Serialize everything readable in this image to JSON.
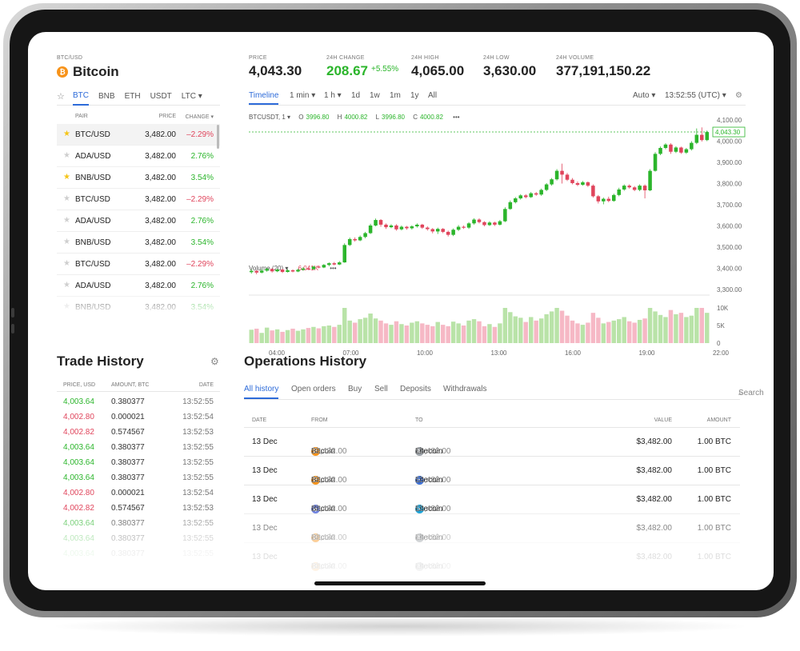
{
  "coin": {
    "pair": "BTC/USD",
    "name": "Bitcoin",
    "icon": "bitcoin-icon",
    "icon_glyph": "₿"
  },
  "stats": {
    "price": {
      "label": "PRICE",
      "value": "4,043.30"
    },
    "change": {
      "label": "24H CHANGE",
      "value": "208.67",
      "pct": "+5.55%"
    },
    "high": {
      "label": "24H HIGH",
      "value": "4,065.00"
    },
    "low": {
      "label": "24H LOW",
      "value": "3,630.00"
    },
    "volume": {
      "label": "24H VOLUME",
      "value": "377,191,150.22"
    }
  },
  "market": {
    "star": "☆",
    "tabs": [
      "BTC",
      "BNB",
      "ETH",
      "USDT",
      "LTC ▾"
    ],
    "headers": {
      "pair": "PAIR",
      "price": "PRICE",
      "change": "CHANGE ▾"
    },
    "rows": [
      {
        "fav": true,
        "pair": "BTC/USD",
        "price": "3,482.00",
        "change": "–2.29%",
        "dir": "down"
      },
      {
        "fav": false,
        "pair": "ADA/USD",
        "price": "3,482.00",
        "change": "2.76%",
        "dir": "up"
      },
      {
        "fav": true,
        "pair": "BNB/USD",
        "price": "3,482.00",
        "change": "3.54%",
        "dir": "up"
      },
      {
        "fav": false,
        "pair": "BTC/USD",
        "price": "3,482.00",
        "change": "–2.29%",
        "dir": "down"
      },
      {
        "fav": false,
        "pair": "ADA/USD",
        "price": "3,482.00",
        "change": "2.76%",
        "dir": "up"
      },
      {
        "fav": false,
        "pair": "BNB/USD",
        "price": "3,482.00",
        "change": "3.54%",
        "dir": "up"
      },
      {
        "fav": false,
        "pair": "BTC/USD",
        "price": "3,482.00",
        "change": "–2.29%",
        "dir": "down"
      },
      {
        "fav": false,
        "pair": "ADA/USD",
        "price": "3,482.00",
        "change": "2.76%",
        "dir": "up"
      },
      {
        "fav": false,
        "pair": "BNB/USD",
        "price": "3,482.00",
        "change": "3.54%",
        "dir": "up"
      }
    ]
  },
  "chart_tabs": {
    "timeline": "Timeline",
    "min": "1 min ▾",
    "hour": "1 h ▾",
    "d": "1d",
    "w": "1w",
    "m": "1m",
    "y": "1y",
    "all": "All",
    "auto": "Auto ▾",
    "clock": "13:52:55 (UTC) ▾"
  },
  "ohlc": {
    "symbol": "BTCUSDT, 1 ▾",
    "o": "3996.80",
    "h": "4000.82",
    "l": "3996.80",
    "c": "4000.82",
    "more": "•••"
  },
  "volume_label": {
    "label": "Volume (20) ▾",
    "value": "6.041K",
    "more": "•••"
  },
  "chart_data": {
    "type": "candlestick",
    "x_ticks": [
      "04:00",
      "07:00",
      "10:00",
      "13:00",
      "16:00",
      "19:00",
      "22:00"
    ],
    "y_ticks": [
      "4,100.00",
      "4,000.00",
      "3,900.00",
      "3,800.00",
      "3,700.00",
      "3,600.00",
      "3,500.00",
      "3,400.00",
      "3,300.00"
    ],
    "ylim": [
      3300,
      4100
    ],
    "last_price_label": "4,043.30",
    "last_price": 4043.3,
    "volume_ticks": [
      "10K",
      "5K",
      "0"
    ],
    "volume_ylim": [
      0,
      10000
    ],
    "candles": [
      [
        3382,
        3388,
        3375,
        3395
      ],
      [
        3388,
        3380,
        3372,
        3392
      ],
      [
        3380,
        3389,
        3376,
        3396
      ],
      [
        3389,
        3397,
        3384,
        3402
      ],
      [
        3397,
        3386,
        3380,
        3400
      ],
      [
        3386,
        3394,
        3382,
        3399
      ],
      [
        3394,
        3383,
        3378,
        3398
      ],
      [
        3383,
        3391,
        3380,
        3396
      ],
      [
        3391,
        3385,
        3381,
        3395
      ],
      [
        3385,
        3393,
        3382,
        3398
      ],
      [
        3393,
        3399,
        3388,
        3405
      ],
      [
        3399,
        3396,
        3392,
        3404
      ],
      [
        3396,
        3408,
        3393,
        3412
      ],
      [
        3408,
        3404,
        3400,
        3414
      ],
      [
        3404,
        3416,
        3401,
        3420
      ],
      [
        3416,
        3424,
        3410,
        3428
      ],
      [
        3424,
        3418,
        3414,
        3430
      ],
      [
        3418,
        3428,
        3415,
        3434
      ],
      [
        3428,
        3510,
        3426,
        3518
      ],
      [
        3510,
        3538,
        3505,
        3545
      ],
      [
        3538,
        3532,
        3526,
        3546
      ],
      [
        3532,
        3548,
        3528,
        3555
      ],
      [
        3548,
        3566,
        3542,
        3572
      ],
      [
        3566,
        3602,
        3562,
        3610
      ],
      [
        3602,
        3628,
        3598,
        3635
      ],
      [
        3628,
        3606,
        3596,
        3632
      ],
      [
        3606,
        3594,
        3586,
        3612
      ],
      [
        3594,
        3602,
        3589,
        3608
      ],
      [
        3602,
        3584,
        3578,
        3608
      ],
      [
        3584,
        3596,
        3579,
        3602
      ],
      [
        3596,
        3589,
        3582,
        3600
      ],
      [
        3589,
        3598,
        3583,
        3603
      ],
      [
        3598,
        3606,
        3592,
        3612
      ],
      [
        3606,
        3592,
        3586,
        3610
      ],
      [
        3592,
        3585,
        3578,
        3598
      ],
      [
        3585,
        3574,
        3565,
        3590
      ],
      [
        3574,
        3586,
        3562,
        3592
      ],
      [
        3586,
        3572,
        3566,
        3590
      ],
      [
        3572,
        3558,
        3550,
        3578
      ],
      [
        3558,
        3582,
        3552,
        3588
      ],
      [
        3582,
        3596,
        3576,
        3604
      ],
      [
        3596,
        3592,
        3586,
        3602
      ],
      [
        3592,
        3612,
        3586,
        3618
      ],
      [
        3612,
        3630,
        3606,
        3636
      ],
      [
        3630,
        3618,
        3612,
        3636
      ],
      [
        3618,
        3604,
        3598,
        3622
      ],
      [
        3604,
        3616,
        3600,
        3622
      ],
      [
        3616,
        3606,
        3600,
        3620
      ],
      [
        3606,
        3622,
        3602,
        3628
      ],
      [
        3622,
        3680,
        3618,
        3688
      ],
      [
        3680,
        3712,
        3676,
        3720
      ],
      [
        3712,
        3730,
        3706,
        3736
      ],
      [
        3730,
        3744,
        3724,
        3750
      ],
      [
        3744,
        3736,
        3730,
        3750
      ],
      [
        3736,
        3754,
        3732,
        3760
      ],
      [
        3754,
        3748,
        3742,
        3760
      ],
      [
        3748,
        3770,
        3742,
        3776
      ],
      [
        3770,
        3796,
        3764,
        3802
      ],
      [
        3796,
        3820,
        3790,
        3826
      ],
      [
        3820,
        3860,
        3814,
        3868
      ],
      [
        3860,
        3842,
        3800,
        3894
      ],
      [
        3842,
        3818,
        3812,
        3850
      ],
      [
        3818,
        3802,
        3796,
        3826
      ],
      [
        3802,
        3794,
        3788,
        3810
      ],
      [
        3794,
        3806,
        3790,
        3812
      ],
      [
        3806,
        3790,
        3784,
        3810
      ],
      [
        3790,
        3740,
        3734,
        3796
      ],
      [
        3740,
        3716,
        3706,
        3746
      ],
      [
        3716,
        3728,
        3702,
        3734
      ],
      [
        3728,
        3718,
        3712,
        3738
      ],
      [
        3718,
        3746,
        3714,
        3752
      ],
      [
        3746,
        3772,
        3740,
        3780
      ],
      [
        3772,
        3790,
        3766,
        3796
      ],
      [
        3790,
        3782,
        3776,
        3796
      ],
      [
        3782,
        3770,
        3764,
        3788
      ],
      [
        3770,
        3790,
        3764,
        3796
      ],
      [
        3790,
        3768,
        3730,
        3796
      ],
      [
        3768,
        3860,
        3764,
        3868
      ],
      [
        3860,
        3940,
        3856,
        3948
      ],
      [
        3940,
        3968,
        3934,
        3975
      ],
      [
        3968,
        3984,
        3962,
        3990
      ],
      [
        3984,
        3950,
        3940,
        3990
      ],
      [
        3950,
        3970,
        3944,
        3976
      ],
      [
        3970,
        3946,
        3940,
        3974
      ],
      [
        3946,
        3962,
        3940,
        3968
      ],
      [
        3962,
        3992,
        3956,
        4000
      ],
      [
        3992,
        4030,
        3986,
        4060
      ],
      [
        4030,
        4005,
        3998,
        4065
      ],
      [
        4005,
        4043,
        4000,
        4050
      ]
    ],
    "volumes": [
      3800,
      4100,
      2900,
      4400,
      3600,
      3900,
      3200,
      3700,
      4100,
      3500,
      3900,
      4300,
      4600,
      4200,
      4800,
      5000,
      4600,
      5200,
      10000,
      6400,
      5800,
      6800,
      7200,
      8400,
      7000,
      6400,
      5600,
      5200,
      6200,
      5400,
      5000,
      5800,
      6200,
      5600,
      5200,
      4800,
      6000,
      5200,
      4800,
      6100,
      5600,
      5000,
      6400,
      6800,
      6200,
      4800,
      5400,
      4600,
      5600,
      10000,
      8800,
      7600,
      7200,
      6000,
      7400,
      6400,
      7000,
      8200,
      9000,
      10000,
      9200,
      7800,
      6400,
      5600,
      5200,
      5800,
      8600,
      7200,
      5600,
      6000,
      6400,
      6800,
      7400,
      6200,
      5800,
      6600,
      7000,
      10000,
      9000,
      8000,
      7400,
      9400,
      8200,
      8600,
      7400,
      7800,
      10000,
      10000,
      8600,
      3800
    ]
  },
  "trade_history": {
    "title": "Trade History",
    "headers": {
      "price": "PRICE, USD",
      "amount": "AMOUNT, BTC",
      "date": "DATE"
    },
    "rows": [
      {
        "price": "4,003.64",
        "amount": "0.380377",
        "date": "13:52:55",
        "dir": "up"
      },
      {
        "price": "4,002.80",
        "amount": "0.000021",
        "date": "13:52:54",
        "dir": "down"
      },
      {
        "price": "4,002.82",
        "amount": "0.574567",
        "date": "13:52:53",
        "dir": "down"
      },
      {
        "price": "4,003.64",
        "amount": "0.380377",
        "date": "13:52:55",
        "dir": "up"
      },
      {
        "price": "4,003.64",
        "amount": "0.380377",
        "date": "13:52:55",
        "dir": "up"
      },
      {
        "price": "4,003.64",
        "amount": "0.380377",
        "date": "13:52:55",
        "dir": "up"
      },
      {
        "price": "4,002.80",
        "amount": "0.000021",
        "date": "13:52:54",
        "dir": "down"
      },
      {
        "price": "4,002.82",
        "amount": "0.574567",
        "date": "13:52:53",
        "dir": "down"
      },
      {
        "price": "4,003.64",
        "amount": "0.380377",
        "date": "13:52:55",
        "dir": "up"
      },
      {
        "price": "4,003.64",
        "amount": "0.380377",
        "date": "13:52:55",
        "dir": "up"
      },
      {
        "price": "4,003.64",
        "amount": "0.380377",
        "date": "13:52:55",
        "dir": "up"
      }
    ]
  },
  "operations": {
    "title": "Operations History",
    "tabs": [
      "All history",
      "Open orders",
      "Buy",
      "Sell",
      "Deposits",
      "Withdrawals"
    ],
    "search": "Search",
    "headers": {
      "date": "DATE",
      "from": "FROM",
      "to": "TO",
      "value": "VALUE",
      "amount": "AMOUNT"
    },
    "rows": [
      {
        "date": "13 Dec",
        "from": "Bitcoin",
        "from_amount": "$3,482.00",
        "from_icon": "bitcoin-icon",
        "from_color": "#f7931a",
        "from_glyph": "₿",
        "to": "Litecoin",
        "to_amount": "$3,482.00",
        "to_icon": "litecoin-icon",
        "to_color": "#9aa0a6",
        "to_glyph": "Ł",
        "value": "$3,482.00",
        "amount": "1.00 BTC"
      },
      {
        "date": "13 Dec",
        "from": "Bitcoin",
        "from_amount": "$3,482.00",
        "from_icon": "bitcoin-icon",
        "from_color": "#f7931a",
        "from_glyph": "₿",
        "to": "Litecoin",
        "to_amount": "$3,482.00",
        "to_icon": "wave-coin-icon",
        "to_color": "#3b6fd6",
        "to_glyph": "~",
        "value": "$3,482.00",
        "amount": "1.00 BTC"
      },
      {
        "date": "13 Dec",
        "from": "Bitcoin",
        "from_amount": "$3,482.00",
        "from_icon": "ethereum-icon",
        "from_color": "#6b7fe0",
        "from_glyph": "◆",
        "to": "Litecoin",
        "to_amount": "$3,482.00",
        "to_icon": "ripple-icon",
        "to_color": "#1aa3d9",
        "to_glyph": "✕",
        "value": "$3,482.00",
        "amount": "1.00 BTC"
      },
      {
        "date": "13 Dec",
        "from": "Bitcoin",
        "from_amount": "$3,482.00",
        "from_icon": "bitcoin-icon",
        "from_color": "#f7931a",
        "from_glyph": "₿",
        "to": "Litecoin",
        "to_amount": "$3,482.00",
        "to_icon": "litecoin-icon",
        "to_color": "#9aa0a6",
        "to_glyph": "Ł",
        "value": "$3,482.00",
        "amount": "1.00 BTC"
      },
      {
        "date": "13 Dec",
        "from": "Bitcoin",
        "from_amount": "$3,482.00",
        "from_icon": "bitcoin-icon",
        "from_color": "#f7931a",
        "from_glyph": "₿",
        "to": "Litecoin",
        "to_amount": "$3,482.00",
        "to_icon": "litecoin-icon",
        "to_color": "#9aa0a6",
        "to_glyph": "Ł",
        "value": "$3,482.00",
        "amount": "1.00 BTC"
      }
    ]
  },
  "colors": {
    "up": "#2bb52b",
    "down": "#e0455c",
    "vol_up": "#b9e3a8",
    "vol_down": "#f6b8c5",
    "accent": "#2d6bd9"
  }
}
